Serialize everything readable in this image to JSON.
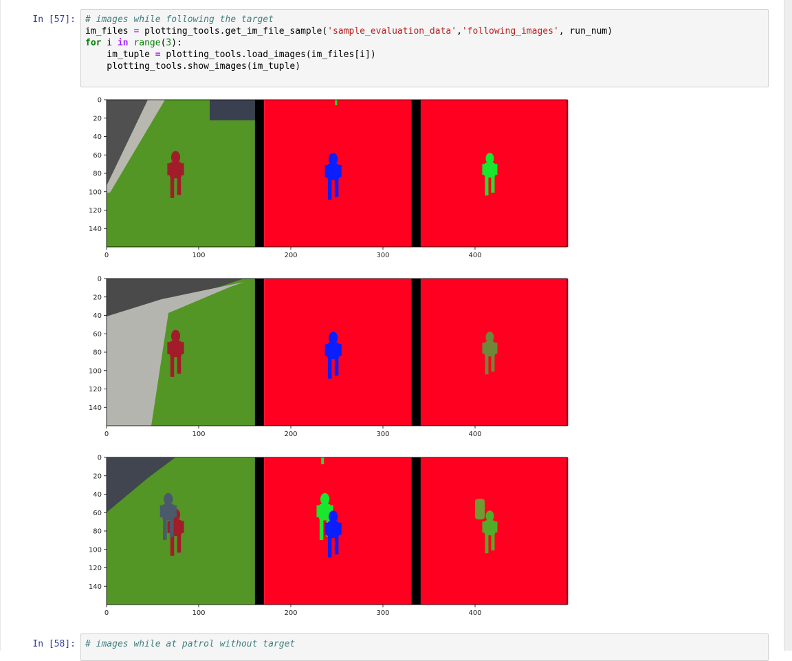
{
  "cell57": {
    "prompt": "In [57]:",
    "code_lines": [
      "# images while following the target",
      "im_files = plotting_tools.get_im_file_sample('sample_evaluation_data','following_images', run_num)",
      "for i in range(3):",
      "    im_tuple = plotting_tools.load_images(im_files[i])",
      "    plotting_tools.show_images(im_tuple)"
    ]
  },
  "figures": {
    "y_ticks": [
      "0",
      "20",
      "40",
      "60",
      "80",
      "100",
      "120",
      "140"
    ],
    "x_ticks": [
      "0",
      "100",
      "200",
      "300",
      "400"
    ],
    "colors": {
      "background": "#ff0020",
      "target": "#0a1eff",
      "other": "#19e62d",
      "grass": "#4d8f22",
      "separator": "#000000"
    },
    "rows": [
      {
        "name": "row-1",
        "scene": "following target on grass near sidewalk"
      },
      {
        "name": "row-2",
        "scene": "following target next to curved sidewalk"
      },
      {
        "name": "row-3",
        "scene": "target with another person nearby"
      }
    ]
  },
  "cell58": {
    "prompt": "In [58]:",
    "code_lines": [
      "# images while at patrol without target"
    ]
  }
}
